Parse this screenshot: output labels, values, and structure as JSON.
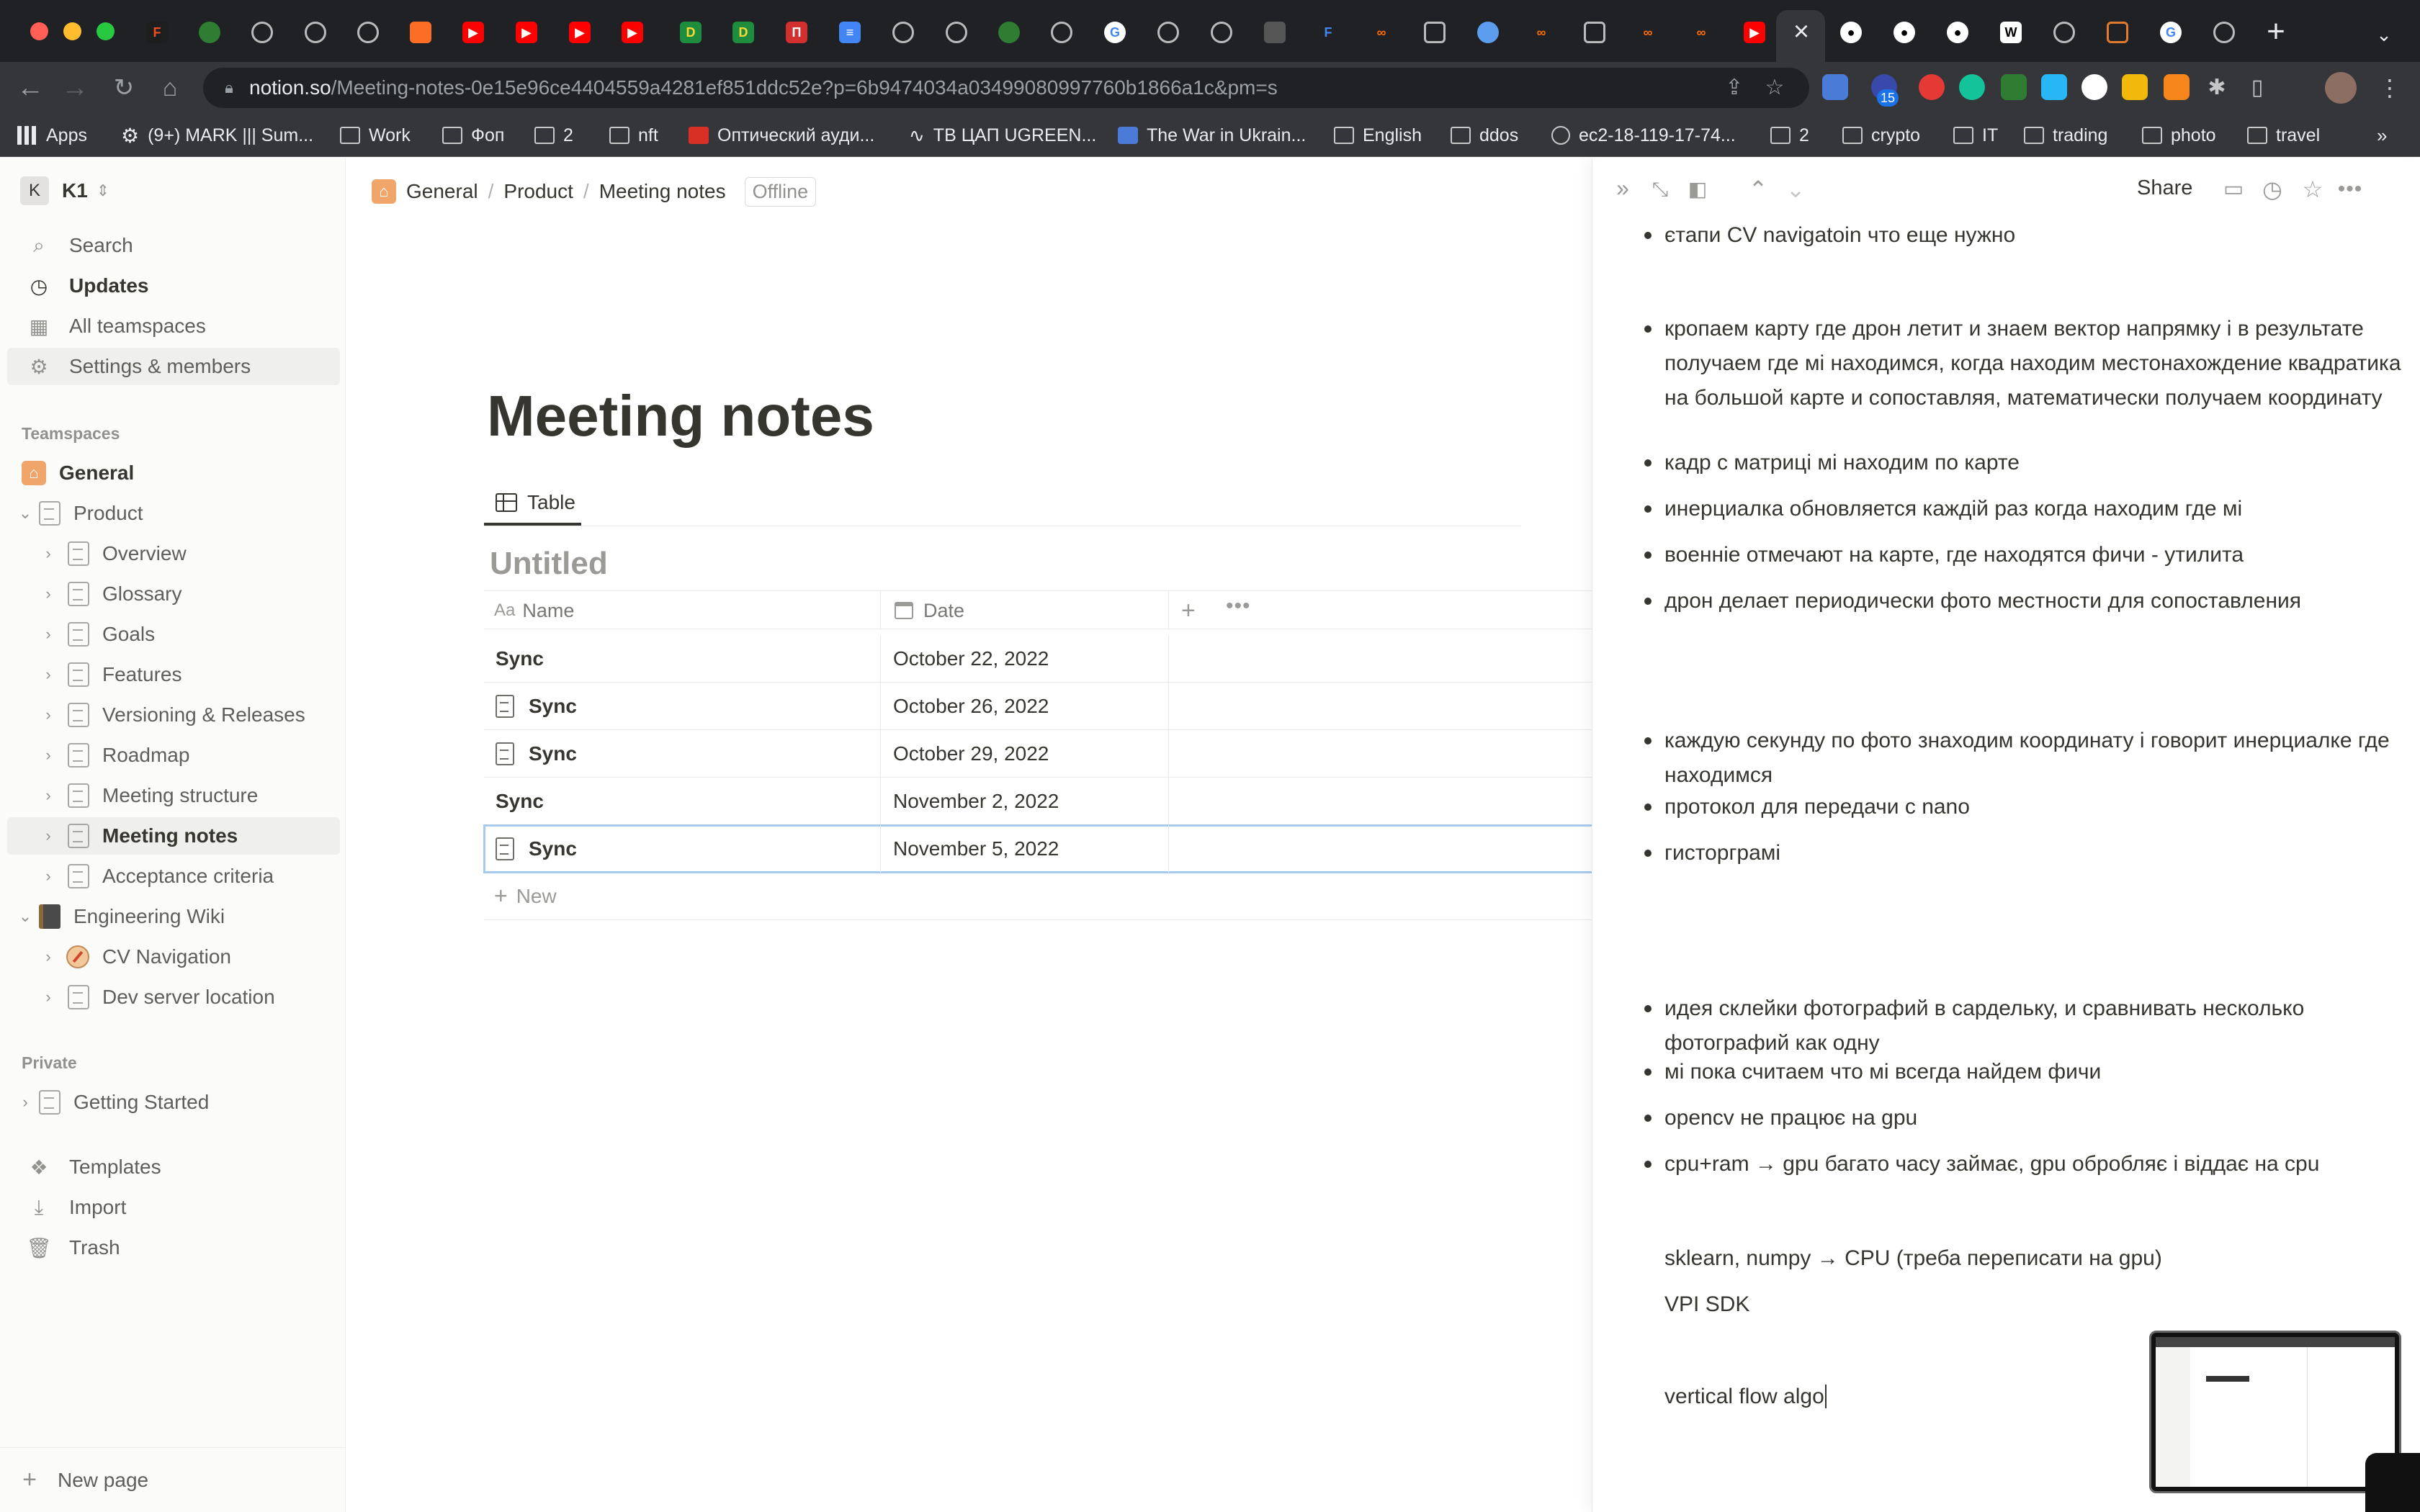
{
  "browser": {
    "url_host": "notion.so",
    "url_path": "/Meeting-notes-0e15e96ce4404559a4281ef851ddc52e?p=6b9474034a03499080997760b1866a1c&pm=s",
    "extension_badge": "15",
    "bookmarks": [
      {
        "label": "Apps",
        "icon": "apps-grid-icon"
      },
      {
        "label": "(9+) MARK ||| Sum...",
        "icon": "gear-icon"
      },
      {
        "label": "Work",
        "icon": "folder-icon"
      },
      {
        "label": "Фоп",
        "icon": "folder-icon"
      },
      {
        "label": "2",
        "icon": "folder-icon"
      },
      {
        "label": "nft",
        "icon": "folder-icon"
      },
      {
        "label": "Оптический ауди...",
        "icon": "red-favicon"
      },
      {
        "label": "ТВ ЦАП UGREEN...",
        "icon": "audio-icon"
      },
      {
        "label": "The War in Ukrain...",
        "icon": "blue-favicon"
      },
      {
        "label": "English",
        "icon": "folder-icon"
      },
      {
        "label": "ddos",
        "icon": "folder-icon"
      },
      {
        "label": "ec2-18-119-17-74...",
        "icon": "globe-icon"
      },
      {
        "label": "2",
        "icon": "folder-icon"
      },
      {
        "label": "crypto",
        "icon": "folder-icon"
      },
      {
        "label": "IT",
        "icon": "folder-icon"
      },
      {
        "label": "trading",
        "icon": "folder-icon"
      },
      {
        "label": "photo",
        "icon": "folder-icon"
      },
      {
        "label": "travel",
        "icon": "folder-icon"
      }
    ]
  },
  "sidebar": {
    "workspace_initial": "K",
    "workspace_name": "K1",
    "top_items": [
      {
        "label": "Search",
        "icon": "search-icon"
      },
      {
        "label": "Updates",
        "icon": "clock-icon"
      },
      {
        "label": "All teamspaces",
        "icon": "building-icon"
      },
      {
        "label": "Settings & members",
        "icon": "gear-icon"
      }
    ],
    "teamspaces_heading": "Teamspaces",
    "tree": [
      {
        "label": "General"
      },
      {
        "label": "Product"
      },
      {
        "label": "Overview"
      },
      {
        "label": "Glossary"
      },
      {
        "label": "Goals"
      },
      {
        "label": "Features"
      },
      {
        "label": "Versioning & Releases"
      },
      {
        "label": "Roadmap"
      },
      {
        "label": "Meeting structure"
      },
      {
        "label": "Meeting notes"
      },
      {
        "label": "Acceptance criteria"
      },
      {
        "label": "Engineering Wiki"
      },
      {
        "label": "CV Navigation"
      },
      {
        "label": "Dev server location"
      }
    ],
    "private_heading": "Private",
    "private_items": [
      {
        "label": "Getting Started"
      }
    ],
    "bottom_items": [
      {
        "label": "Templates",
        "icon": "templates-icon"
      },
      {
        "label": "Import",
        "icon": "import-icon"
      },
      {
        "label": "Trash",
        "icon": "trash-icon"
      }
    ],
    "new_page": "New page"
  },
  "topbar": {
    "breadcrumbs": [
      "General",
      "Product",
      "Meeting notes"
    ],
    "status": "Offline"
  },
  "page": {
    "title": "Meeting notes",
    "view_tab": "Table",
    "database_title": "Untitled",
    "columns": {
      "name": "Name",
      "name_prefix": "Aa",
      "date": "Date"
    },
    "rows": [
      {
        "name": "Sync",
        "date": "October 22, 2022",
        "has_doc": false
      },
      {
        "name": "Sync",
        "date": "October 26, 2022",
        "has_doc": true
      },
      {
        "name": "Sync",
        "date": "October 29, 2022",
        "has_doc": true
      },
      {
        "name": "Sync",
        "date": "November 2, 2022",
        "has_doc": false
      },
      {
        "name": "Sync",
        "date": "November 5, 2022",
        "has_doc": true
      }
    ],
    "new_row": "New"
  },
  "peek": {
    "share": "Share",
    "bullets": [
      "єтапи CV navigatoin что еще нужно",
      "кропаем карту где дрон летит и знаем вектор напрямку і в результате получаем где мі находимся, когда находим местонахождение квадратика на большой карте и сопоставляя, математически получаем координату",
      "кадр с матриці мі находим по карте",
      "инерциалка обновляется каждій раз когда находим где мі",
      "военніе отмечают на карте, где находятся фичи - утилита",
      "дрон делает периодически фото местности для сопоставления",
      "каждую секунду по фото знаходим координату і говорит инерциалке где находимся",
      "протокол для передачи с nano",
      "гисторграмі",
      "идея склейки фотографий в сардельку, и сравнивать несколько фотографий как одну",
      "мі пока считаем что мі всегда найдем фичи",
      "opencv не працює на gpu",
      "cpu+ram → gpu багато часу займає, gpu обробляє і віддає на cpu"
    ],
    "paragraphs": [
      "sklearn, numpy → CPU (треба переписати на gpu)",
      "VPI SDK",
      "vertical flow algo"
    ]
  }
}
